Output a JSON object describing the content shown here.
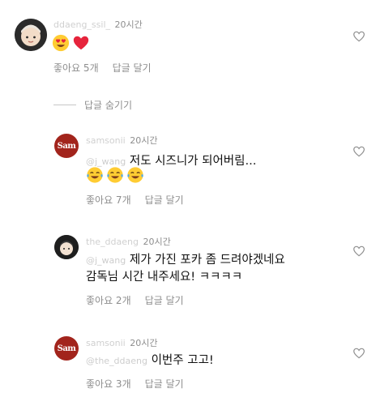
{
  "top_comment": {
    "username": "ddaeng_ssil_",
    "time": "20시간",
    "likes_label": "좋아요 5개",
    "reply_label": "답글 달기"
  },
  "hide_replies_label": "답글 숨기기",
  "replies": [
    {
      "username": "samsonii",
      "time": "20시간",
      "mention": "@j_wang",
      "text": "저도 시즈니가 되어버림...",
      "likes_label": "좋아요 7개",
      "reply_label": "답글 달기"
    },
    {
      "username": "the_ddaeng",
      "time": "20시간",
      "mention": "@j_wang",
      "text_line1": "제가 가진 포카 좀 드려야겠네요",
      "text_line2": "감독님 시간 내주세요! ㅋㅋㅋㅋ",
      "likes_label": "좋아요 2개",
      "reply_label": "답글 달기"
    },
    {
      "username": "samsonii",
      "time": "20시간",
      "mention": "@the_ddaeng",
      "text": "이번주 고고!",
      "likes_label": "좋아요 3개",
      "reply_label": "답글 달기"
    }
  ],
  "brand_avatar_text": "Sam",
  "colors": {
    "heart_red": "#e6243c",
    "muted": "#8e8e8e",
    "brand": "#a2241c"
  },
  "icons": [
    "heart-eyes-emoji",
    "red-heart-emoji",
    "tears-of-joy-emoji",
    "like-heart-icon"
  ]
}
